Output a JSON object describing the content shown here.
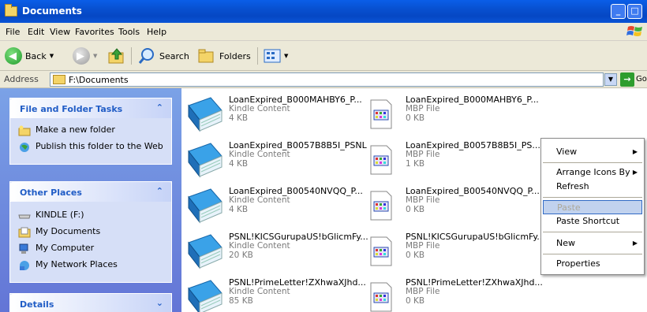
{
  "window": {
    "title": "Documents",
    "buttons": [
      "_",
      "□",
      "X"
    ]
  },
  "menubar": [
    "File",
    "Edit",
    "View",
    "Favorites",
    "Tools",
    "Help"
  ],
  "toolbar": {
    "back": "Back",
    "search": "Search",
    "folders": "Folders"
  },
  "address": {
    "label": "Address",
    "path": "F:\\Documents",
    "go": "Go"
  },
  "left": {
    "tasks": {
      "title": "File and Folder Tasks",
      "items": [
        "Make a new folder",
        "Publish this folder to the Web"
      ]
    },
    "places": {
      "title": "Other Places",
      "items": [
        "KINDLE (F:)",
        "My Documents",
        "My Computer",
        "My Network Places"
      ]
    },
    "details": {
      "title": "Details"
    }
  },
  "files": [
    {
      "name": "LoanExpired_B000MAHBY6_P...",
      "type": "Kindle Content",
      "size": "4 KB",
      "kind": "book"
    },
    {
      "name": "LoanExpired_B000MAHBY6_P...",
      "type": "MBP File",
      "size": "0 KB",
      "kind": "mbp"
    },
    {
      "name": "LoanExpired_B0057B8B5I_PSNL",
      "type": "Kindle Content",
      "size": "4 KB",
      "kind": "book"
    },
    {
      "name": "LoanExpired_B0057B8B5I_PS...",
      "type": "MBP File",
      "size": "1 KB",
      "kind": "mbp"
    },
    {
      "name": "LoanExpired_B00540NVQQ_P...",
      "type": "Kindle Content",
      "size": "4 KB",
      "kind": "book"
    },
    {
      "name": "LoanExpired_B00540NVQQ_P...",
      "type": "MBP File",
      "size": "0 KB",
      "kind": "mbp"
    },
    {
      "name": "PSNL!KICSGurupaUS!bGlicmFy...",
      "type": "Kindle Content",
      "size": "20 KB",
      "kind": "book"
    },
    {
      "name": "PSNL!KICSGurupaUS!bGlicmFy...",
      "type": "MBP File",
      "size": "0 KB",
      "kind": "mbp"
    },
    {
      "name": "PSNL!PrimeLetter!ZXhwaXJhd...",
      "type": "Kindle Content",
      "size": "85 KB",
      "kind": "book"
    },
    {
      "name": "PSNL!PrimeLetter!ZXhwaXJhd...",
      "type": "MBP File",
      "size": "0 KB",
      "kind": "mbp"
    }
  ],
  "contextmenu": {
    "view": "View",
    "arrange": "Arrange Icons By",
    "refresh": "Refresh",
    "paste": "Paste",
    "paste_shortcut": "Paste Shortcut",
    "new": "New",
    "properties": "Properties"
  }
}
